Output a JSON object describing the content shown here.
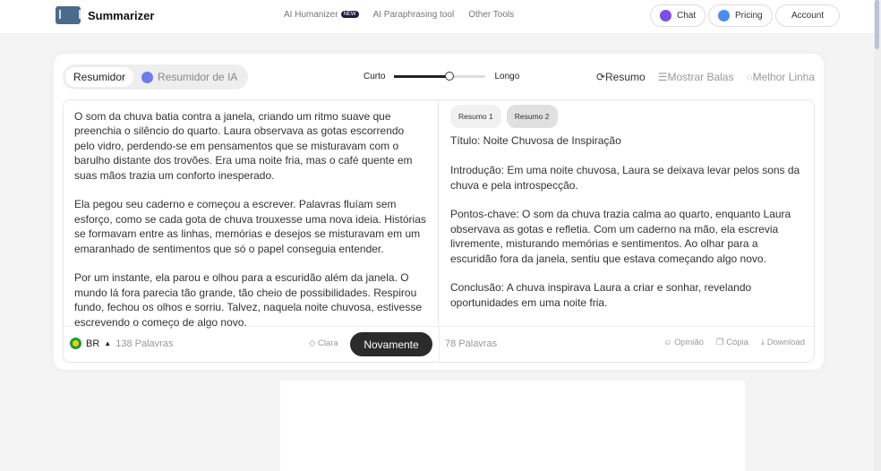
{
  "header": {
    "brand": "Summarizer",
    "nav": [
      {
        "label": "AI Humanizer",
        "badge": "NEW"
      },
      {
        "label": "AI Paraphrasing tool"
      },
      {
        "label": "Other Tools"
      }
    ],
    "chat": "Chat",
    "pricing": "Pricing",
    "account": "Account"
  },
  "toolbar": {
    "modes": [
      "Resumidor",
      "Resumidor de IA"
    ],
    "short": "Curto",
    "long": "Longo",
    "length_percent": 60,
    "options": [
      "Resumo",
      "Mostrar Balas",
      "Melhor Linha"
    ]
  },
  "input": {
    "paragraphs": [
      "O som da chuva batia contra a janela, criando um ritmo suave que preenchia o silêncio do quarto. Laura observava as gotas escorrendo pelo vidro, perdendo-se em pensamentos que se misturavam com o barulho distante dos trovões. Era uma noite fria, mas o café quente em suas mãos trazia um conforto inesperado.",
      "Ela pegou seu caderno e começou a escrever. Palavras fluíam sem esforço, como se cada gota de chuva trouxesse uma nova ideia. Histórias se formavam entre as linhas, memórias e desejos se misturavam em um emaranhado de sentimentos que só o papel conseguia entender.",
      "Por um instante, ela parou e olhou para a escuridão além da janela. O mundo lá fora parecia tão grande, tão cheio de possibilidades. Respirou fundo, fechou os olhos e sorriu. Talvez, naquela noite chuvosa, estivesse escrevendo o começo de algo novo."
    ],
    "lang": "BR",
    "words": "138 Palavras",
    "clear": "Clara",
    "again": "Novamente"
  },
  "output": {
    "tabs": [
      "Resumo 1",
      "Resumo 2"
    ],
    "paragraphs": [
      "Título: Noite Chuvosa de Inspiração",
      "Introdução: Em uma noite chuvosa, Laura se deixava levar pelos sons da chuva e pela introspecção.",
      "Pontos-chave: O som da chuva trazia calma ao quarto, enquanto Laura observava as gotas e refletia. Com um caderno na mão, ela escrevia livremente, misturando memórias e sentimentos. Ao olhar para a escuridão fora da janela, sentiu que estava começando algo novo.",
      "Conclusão: A chuva inspirava Laura a criar e sonhar, revelando oportunidades em uma noite fria."
    ],
    "words": "78 Palavras",
    "feedback": "Opinião",
    "copy": "Cópia",
    "download": "Download"
  }
}
